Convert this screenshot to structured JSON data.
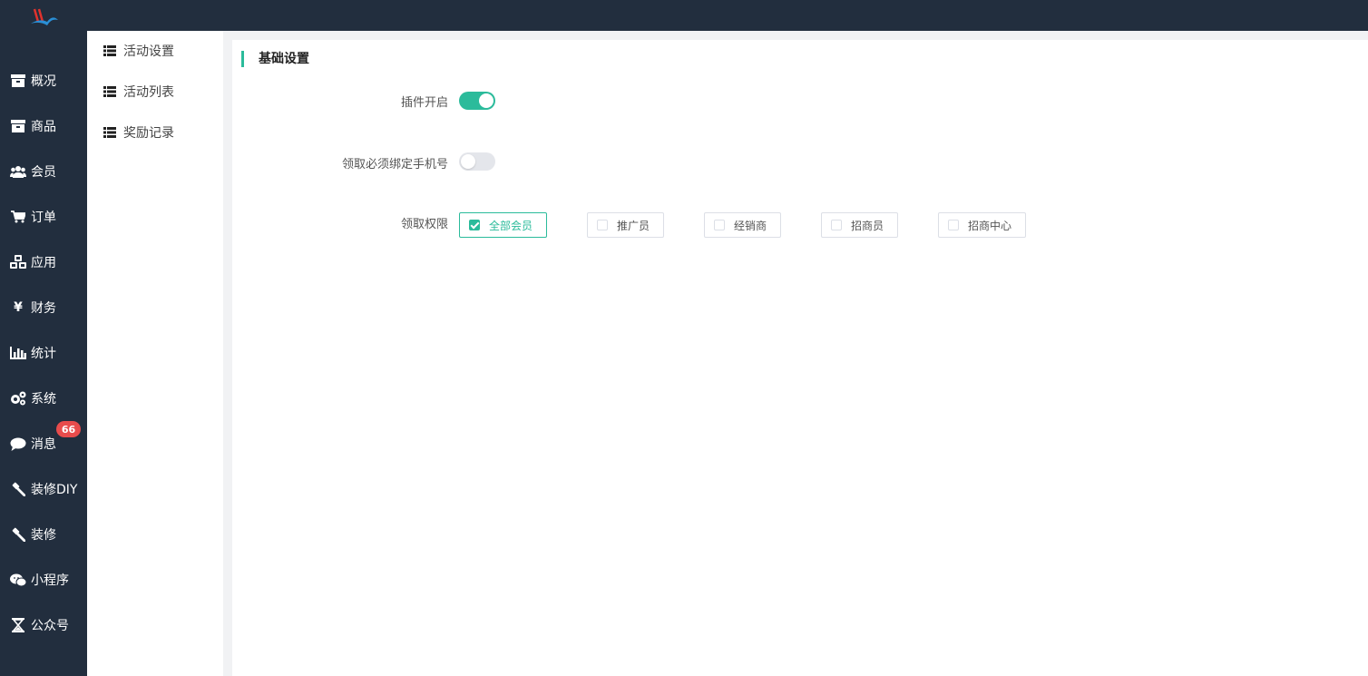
{
  "sidebar": {
    "items": [
      {
        "label": "概况",
        "icon": "archive-icon"
      },
      {
        "label": "商品",
        "icon": "archive-icon"
      },
      {
        "label": "会员",
        "icon": "users-icon"
      },
      {
        "label": "订单",
        "icon": "cart-icon"
      },
      {
        "label": "应用",
        "icon": "cubes-icon"
      },
      {
        "label": "财务",
        "icon": "yen-icon"
      },
      {
        "label": "统计",
        "icon": "bar-chart-icon"
      },
      {
        "label": "系统",
        "icon": "gears-icon"
      },
      {
        "label": "消息",
        "icon": "comment-icon"
      },
      {
        "label": "装修DIY",
        "icon": "gavel-icon"
      },
      {
        "label": "装修",
        "icon": "gavel-icon"
      },
      {
        "label": "小程序",
        "icon": "wechat-icon"
      },
      {
        "label": "公众号",
        "icon": "hourglass-icon"
      }
    ],
    "message_badge": "66"
  },
  "subnav": {
    "items": [
      {
        "label": "活动设置",
        "icon": "list-icon"
      },
      {
        "label": "活动列表",
        "icon": "list-icon"
      },
      {
        "label": "奖励记录",
        "icon": "list-icon"
      }
    ]
  },
  "main": {
    "section_title": "基础设置",
    "plugin_enable": {
      "label": "插件开启",
      "on": true
    },
    "bind_phone": {
      "label": "领取必须绑定手机号",
      "on": false
    },
    "permission": {
      "label": "领取权限",
      "options": [
        {
          "label": "全部会员",
          "checked": true
        },
        {
          "label": "推广员",
          "checked": false
        },
        {
          "label": "经销商",
          "checked": false
        },
        {
          "label": "招商员",
          "checked": false
        },
        {
          "label": "招商中心",
          "checked": false
        }
      ]
    }
  },
  "colors": {
    "accent": "#2bbb9b",
    "sidebar_bg": "#222e3e",
    "badge": "#e84c4c"
  }
}
